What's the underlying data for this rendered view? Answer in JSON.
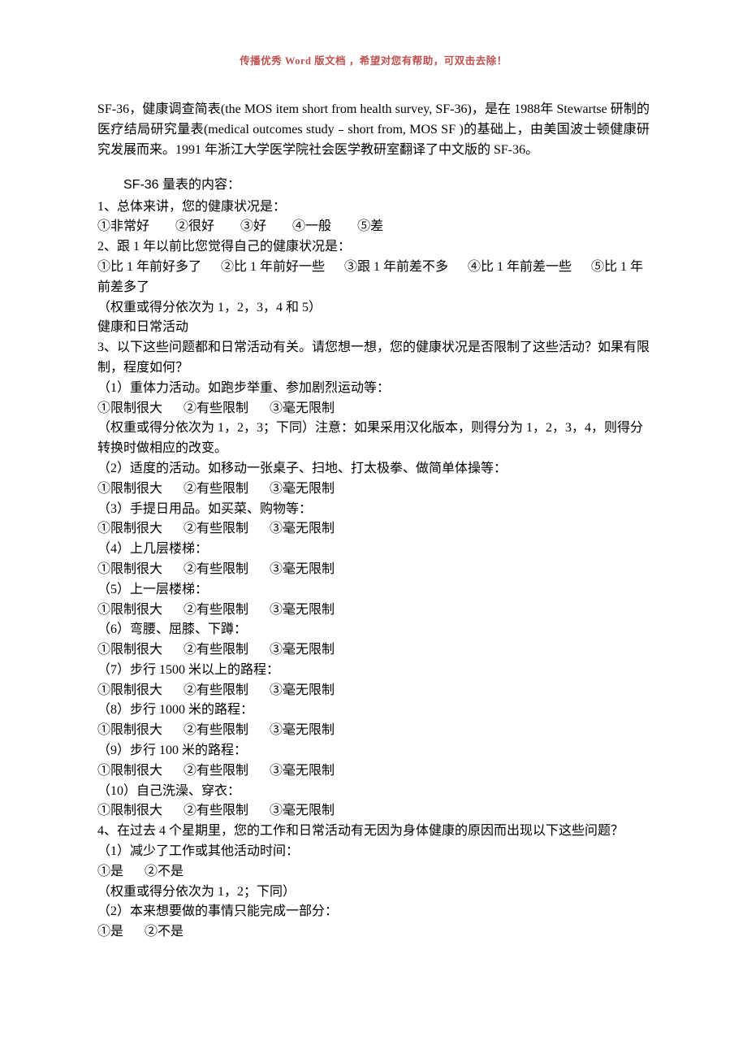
{
  "header_note": "传播优秀 Word 版文档 ，希望对您有帮助，可双击去除！",
  "intro": "SF-36，健康调查简表(the MOS item short from health survey, SF-36)，是在 1988年 Stewartse 研制的医疗结局研究量表(medical outcomes study﹣short from, MOS SF )的基础上，由美国波士顿健康研究发展而来。1991 年浙江大学医学院社会医学教研室翻译了中文版的 SF-36。",
  "section_title": "SF-36 量表的内容：",
  "q1": "1、总体来讲，您的健康状况是：",
  "q1_opts": [
    "①非常好",
    "②很好",
    "③好",
    "④一般",
    "⑤差"
  ],
  "q2": "2、跟 1 年以前比您觉得自己的健康状况是：",
  "q2_opts": "①比 1 年前好多了  ②比 1 年前好一些  ③跟 1 年前差不多  ④比 1 年前差一些  ⑤比 1 年前差多了",
  "q2_note": "（权重或得分依次为 1，2，3，4 和 5）",
  "sec2_header": "健康和日常活动",
  "q3": "3、以下这些问题都和日常活动有关。请您想一想，您的健康状况是否限制了这些活动？如果有限制，程度如何？",
  "q3_items": [
    "（1）重体力活动。如跑步举重、参加剧烈运动等：",
    "（2）适度的活动。如移动一张桌子、扫地、打太极拳、做简单体操等：",
    "（3）手提日用品。如买菜、购物等：",
    "（4）上几层楼梯：",
    "（5）上一层楼梯：",
    "（6）弯腰、屈膝、下蹲：",
    "（7）步行 1500 米以上的路程：",
    "（8）步行 1000 米的路程：",
    "（9）步行 100 米的路程：",
    "（10）自己洗澡、穿衣："
  ],
  "q3_opts": [
    "①限制很大",
    "②有些限制",
    "③毫无限制"
  ],
  "q3_note": "（权重或得分依次为 1，2，3；下同）注意：如果采用汉化版本，则得分为 1，2，3，4，则得分转换时做相应的改变。",
  "q4": "4、在过去 4 个星期里，您的工作和日常活动有无因为身体健康的原因而出现以下这些问题？",
  "q4_items": [
    "（1）减少了工作或其他活动时间：",
    "（2）本来想要做的事情只能完成一部分："
  ],
  "q4_opts": [
    "①是",
    "②不是"
  ],
  "q4_note": "（权重或得分依次为 1，2；下同）"
}
